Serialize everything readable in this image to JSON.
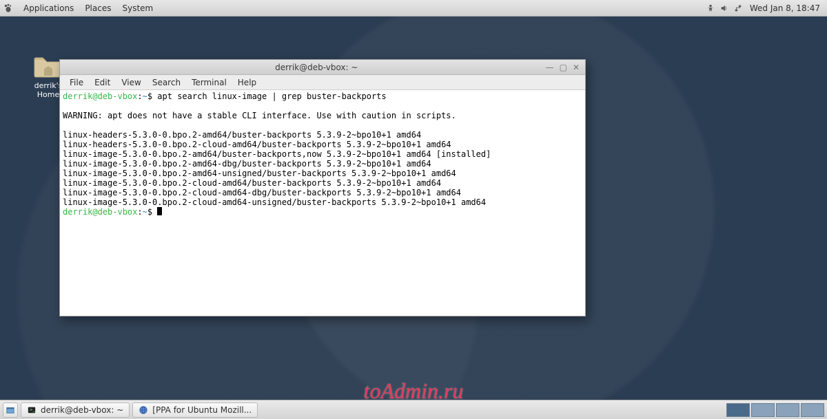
{
  "topbar": {
    "menus": [
      "Applications",
      "Places",
      "System"
    ],
    "clock": "Wed Jan  8, 18:47"
  },
  "desktop": {
    "home_label": "derrik's Home"
  },
  "terminal": {
    "title": "derrik@deb-vbox: ~",
    "menus": [
      "File",
      "Edit",
      "View",
      "Search",
      "Terminal",
      "Help"
    ],
    "prompt_user": "derrik@deb-vbox",
    "prompt_sep1": ":",
    "prompt_path": "~",
    "prompt_sep2": "$ ",
    "command": "apt search linux-image | grep buster-backports",
    "blank1": "",
    "warning": "WARNING: apt does not have a stable CLI interface. Use with caution in scripts.",
    "blank2": "",
    "output": [
      "linux-headers-5.3.0-0.bpo.2-amd64/buster-backports 5.3.9-2~bpo10+1 amd64",
      "linux-headers-5.3.0-0.bpo.2-cloud-amd64/buster-backports 5.3.9-2~bpo10+1 amd64",
      "linux-image-5.3.0-0.bpo.2-amd64/buster-backports,now 5.3.9-2~bpo10+1 amd64 [installed]",
      "linux-image-5.3.0-0.bpo.2-amd64-dbg/buster-backports 5.3.9-2~bpo10+1 amd64",
      "linux-image-5.3.0-0.bpo.2-amd64-unsigned/buster-backports 5.3.9-2~bpo10+1 amd64",
      "linux-image-5.3.0-0.bpo.2-cloud-amd64/buster-backports 5.3.9-2~bpo10+1 amd64",
      "linux-image-5.3.0-0.bpo.2-cloud-amd64-dbg/buster-backports 5.3.9-2~bpo10+1 amd64",
      "linux-image-5.3.0-0.bpo.2-cloud-amd64-unsigned/buster-backports 5.3.9-2~bpo10+1 amd64"
    ]
  },
  "taskbar": {
    "items": [
      {
        "label": "derrik@deb-vbox: ~"
      },
      {
        "label": "[PPA for Ubuntu Mozill..."
      }
    ]
  },
  "watermark": "toAdmin.ru"
}
